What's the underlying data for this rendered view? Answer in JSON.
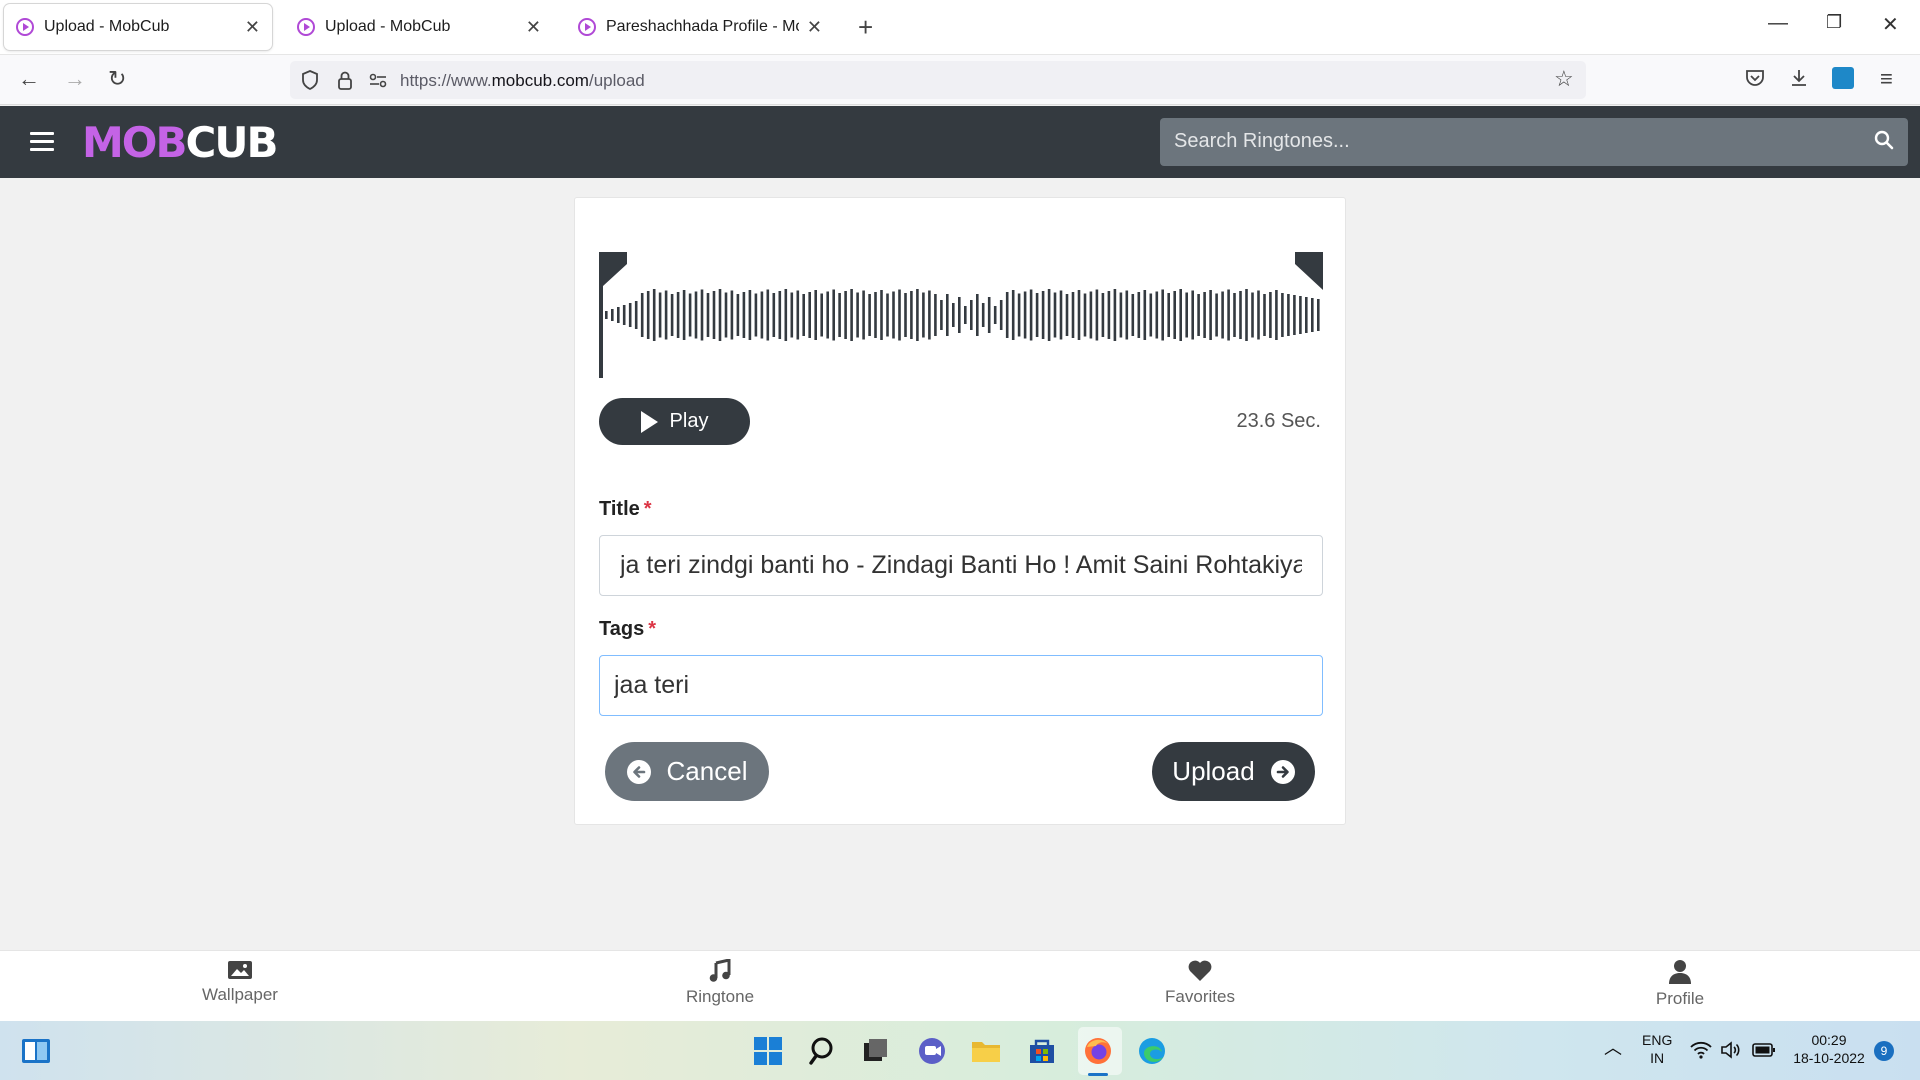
{
  "browser": {
    "tabs": [
      {
        "title": "Upload - MobCub",
        "active": true
      },
      {
        "title": "Upload - MobCub",
        "active": false
      },
      {
        "title": "Pareshachhada Profile - MobCub",
        "active": false
      }
    ],
    "url_prefix": "https://www.",
    "url_domain": "mobcub.com",
    "url_path": "/upload"
  },
  "header": {
    "logo_text_left": "M",
    "logo_text_mid": "OB",
    "logo_text_right": "CUB",
    "search_placeholder": "Search Ringtones..."
  },
  "player": {
    "play_label": "Play",
    "duration": "23.6 Sec."
  },
  "form": {
    "title_label": "Title",
    "title_value": "ja teri zindgi banti ho - Zindagi Banti Ho ! Amit Saini Rohtakiya",
    "tags_label": "Tags",
    "tags_value": "jaa teri ",
    "required_mark": "*",
    "cancel_label": "Cancel",
    "upload_label": "Upload"
  },
  "bottom_nav": [
    {
      "label": "Wallpaper",
      "icon": "image-icon"
    },
    {
      "label": "Ringtone",
      "icon": "music-note-icon"
    },
    {
      "label": "Favorites",
      "icon": "heart-icon"
    },
    {
      "label": "Profile",
      "icon": "user-icon"
    }
  ],
  "taskbar": {
    "language_top": "ENG",
    "language_bottom": "IN",
    "time": "00:29",
    "date": "18-10-2022",
    "notification_count": "9"
  },
  "colors": {
    "header_bg": "#343a40",
    "accent": "#c463e6",
    "button_dark": "#343a40",
    "button_gray": "#6c757d"
  }
}
